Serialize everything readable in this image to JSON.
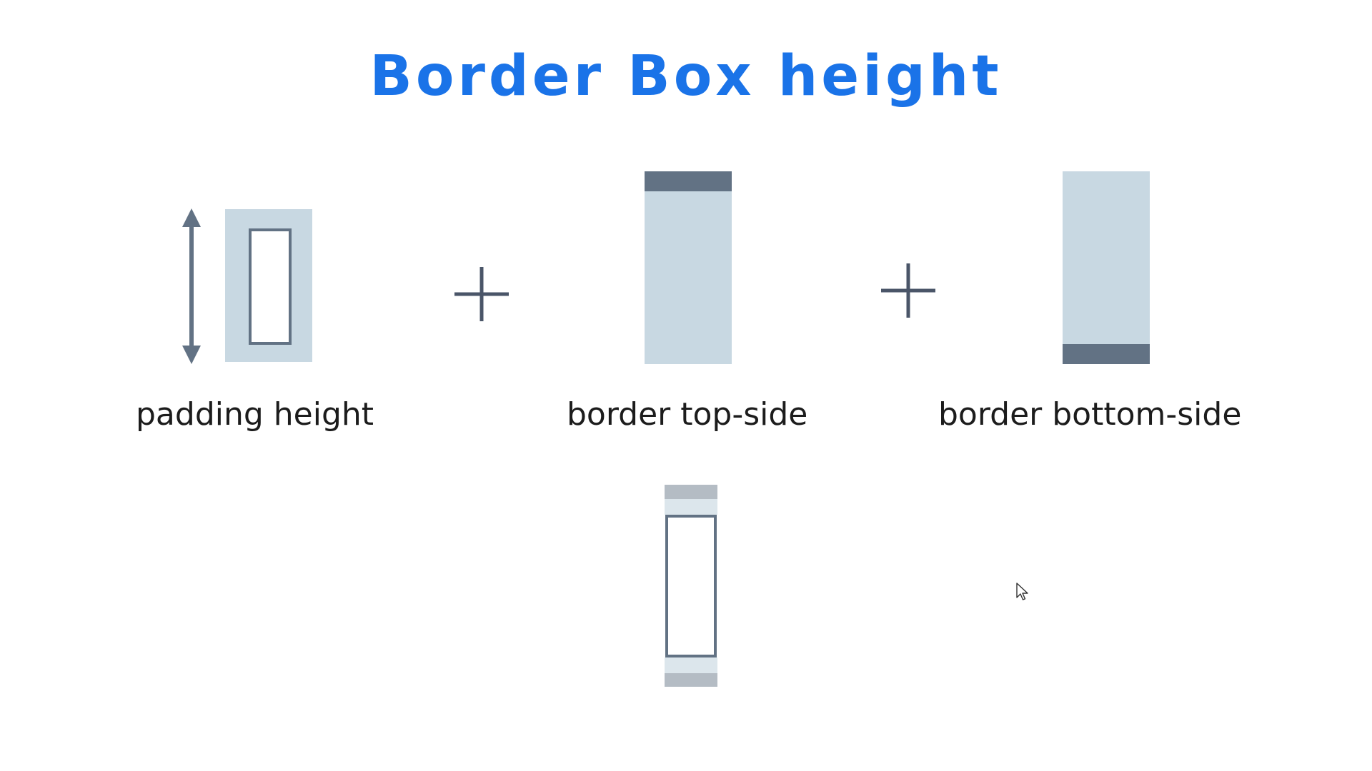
{
  "title": "Border Box height",
  "labels": {
    "padding_height": "padding height",
    "border_top_side": "border top-side",
    "border_bottom_side": "border bottom-side"
  },
  "colors": {
    "title": "#1a73e8",
    "padding_fill": "#c8d8e2",
    "border_fill": "#627284",
    "content_outline": "#627284",
    "result_border": "#b4bcc4",
    "result_padding": "#dce6ec"
  },
  "icons": {
    "plus_1": "plus-icon",
    "plus_2": "plus-icon",
    "height_arrow": "vertical-double-arrow-icon",
    "cursor": "mouse-pointer-icon"
  }
}
